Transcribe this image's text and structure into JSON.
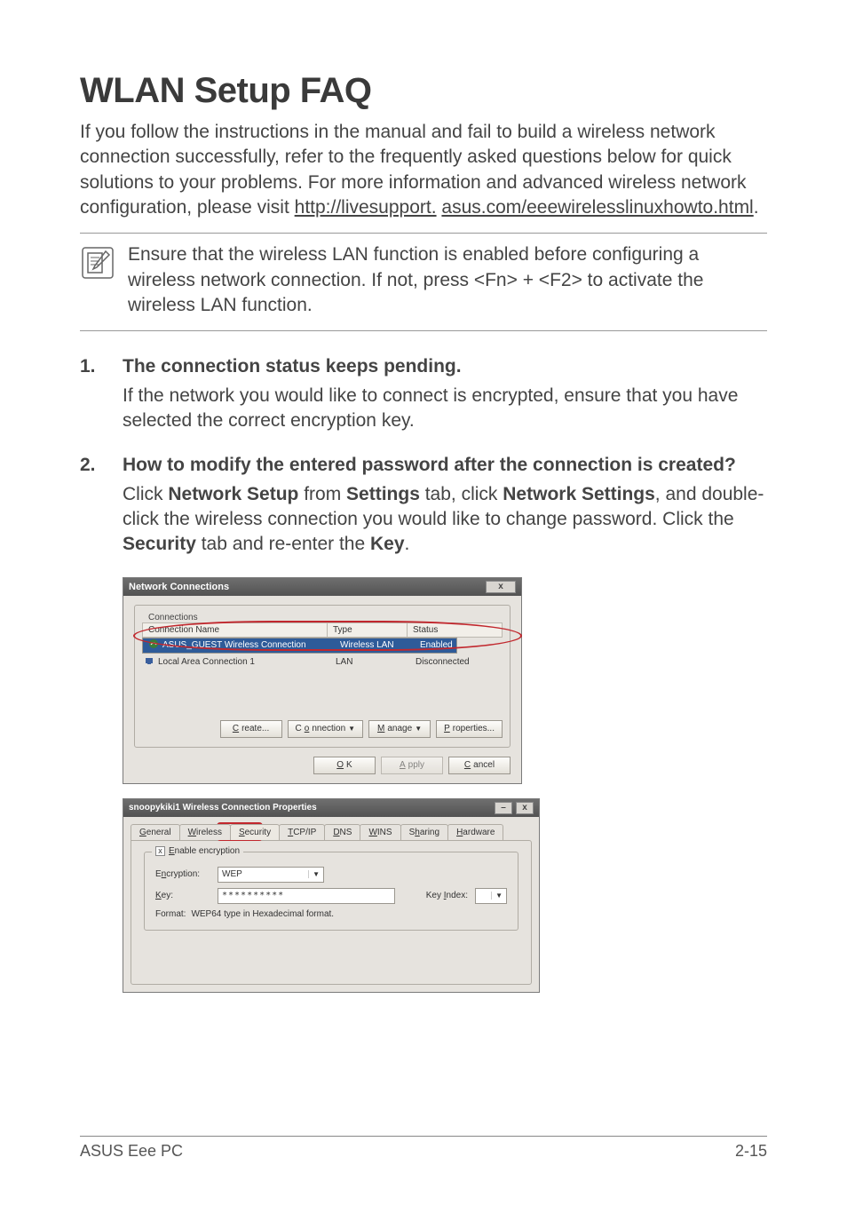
{
  "heading": "WLAN Setup FAQ",
  "intro_pre": "If you follow the instructions in the manual and fail to build a wireless network connection successfully, refer to the frequently asked questions below for quick solutions to your problems. For more information and advanced wireless network configuration, please visit ",
  "intro_link1": "http://livesupport.",
  "intro_link2": "asus.com/eeewirelesslinuxhowto.html",
  "intro_post": ".",
  "note": "Ensure that the wireless LAN function is enabled before configuring a wireless network connection. If not, press <Fn> + <F2> to activate the wireless LAN function.",
  "faq": [
    {
      "num": "1.",
      "q": "The connection status keeps pending.",
      "a_html": "If the network you would like to connect is encrypted, ensure that you have selected the correct encryption key."
    },
    {
      "num": "2.",
      "q": "How to modify the entered password after the connection is created?",
      "a_pre": "Click ",
      "a_b1": "Network Setup",
      "a_mid1": " from ",
      "a_b2": "Settings",
      "a_mid2": " tab, click ",
      "a_b3": "Network Settings",
      "a_mid3": ", and double-click the wireless connection you would like to change password. Click the ",
      "a_b4": "Security",
      "a_mid4": " tab and re-enter the ",
      "a_b5": "Key",
      "a_post": "."
    }
  ],
  "dlg1": {
    "title": "Network Connections",
    "close": "x",
    "fieldset": "Connections",
    "columns": {
      "name": "Connection Name",
      "type": "Type",
      "status": "Status"
    },
    "rows": [
      {
        "name": "ASUS_GUEST Wireless Connection",
        "type": "Wireless LAN",
        "status": "Enabled",
        "selected": true
      },
      {
        "name": "Local Area Connection 1",
        "type": "LAN",
        "status": "Disconnected",
        "selected": false
      }
    ],
    "buttons": {
      "create": "Create...",
      "connection": "Connection",
      "manage": "Manage",
      "properties": "Properties..."
    },
    "buttons2": {
      "ok": "OK",
      "apply": "Apply",
      "cancel": "Cancel"
    },
    "accel": {
      "create": "C",
      "connection": "o",
      "manage": "M",
      "properties": "P",
      "ok": "O",
      "apply": "A",
      "cancel": "C"
    }
  },
  "dlg2": {
    "title": "snoopykiki1 Wireless Connection Properties",
    "min": "–",
    "close": "x",
    "tabs": [
      "General",
      "Wireless",
      "Security",
      "TCP/IP",
      "DNS",
      "WINS",
      "Sharing",
      "Hardware"
    ],
    "active_tab_index": 2,
    "checkbox_label": "Enable encryption",
    "checkbox_checked": "x",
    "encryption_label": "Encryption:",
    "encryption_value": "WEP",
    "key_label": "Key:",
    "key_value": "**********",
    "keyindex_label": "Key Index:",
    "keyindex_value": "",
    "format_label": "Format:",
    "format_value": "WEP64 type in Hexadecimal format.",
    "accel": {
      "general": "G",
      "wireless": "W",
      "security": "S",
      "tcpip": "T",
      "dns": "D",
      "wins": "W",
      "sharing": "h",
      "hardware": "H",
      "enable": "E",
      "encryption": "n",
      "key": "K",
      "index": "I"
    }
  },
  "footer": {
    "left": "ASUS Eee PC",
    "right": "2-15"
  }
}
